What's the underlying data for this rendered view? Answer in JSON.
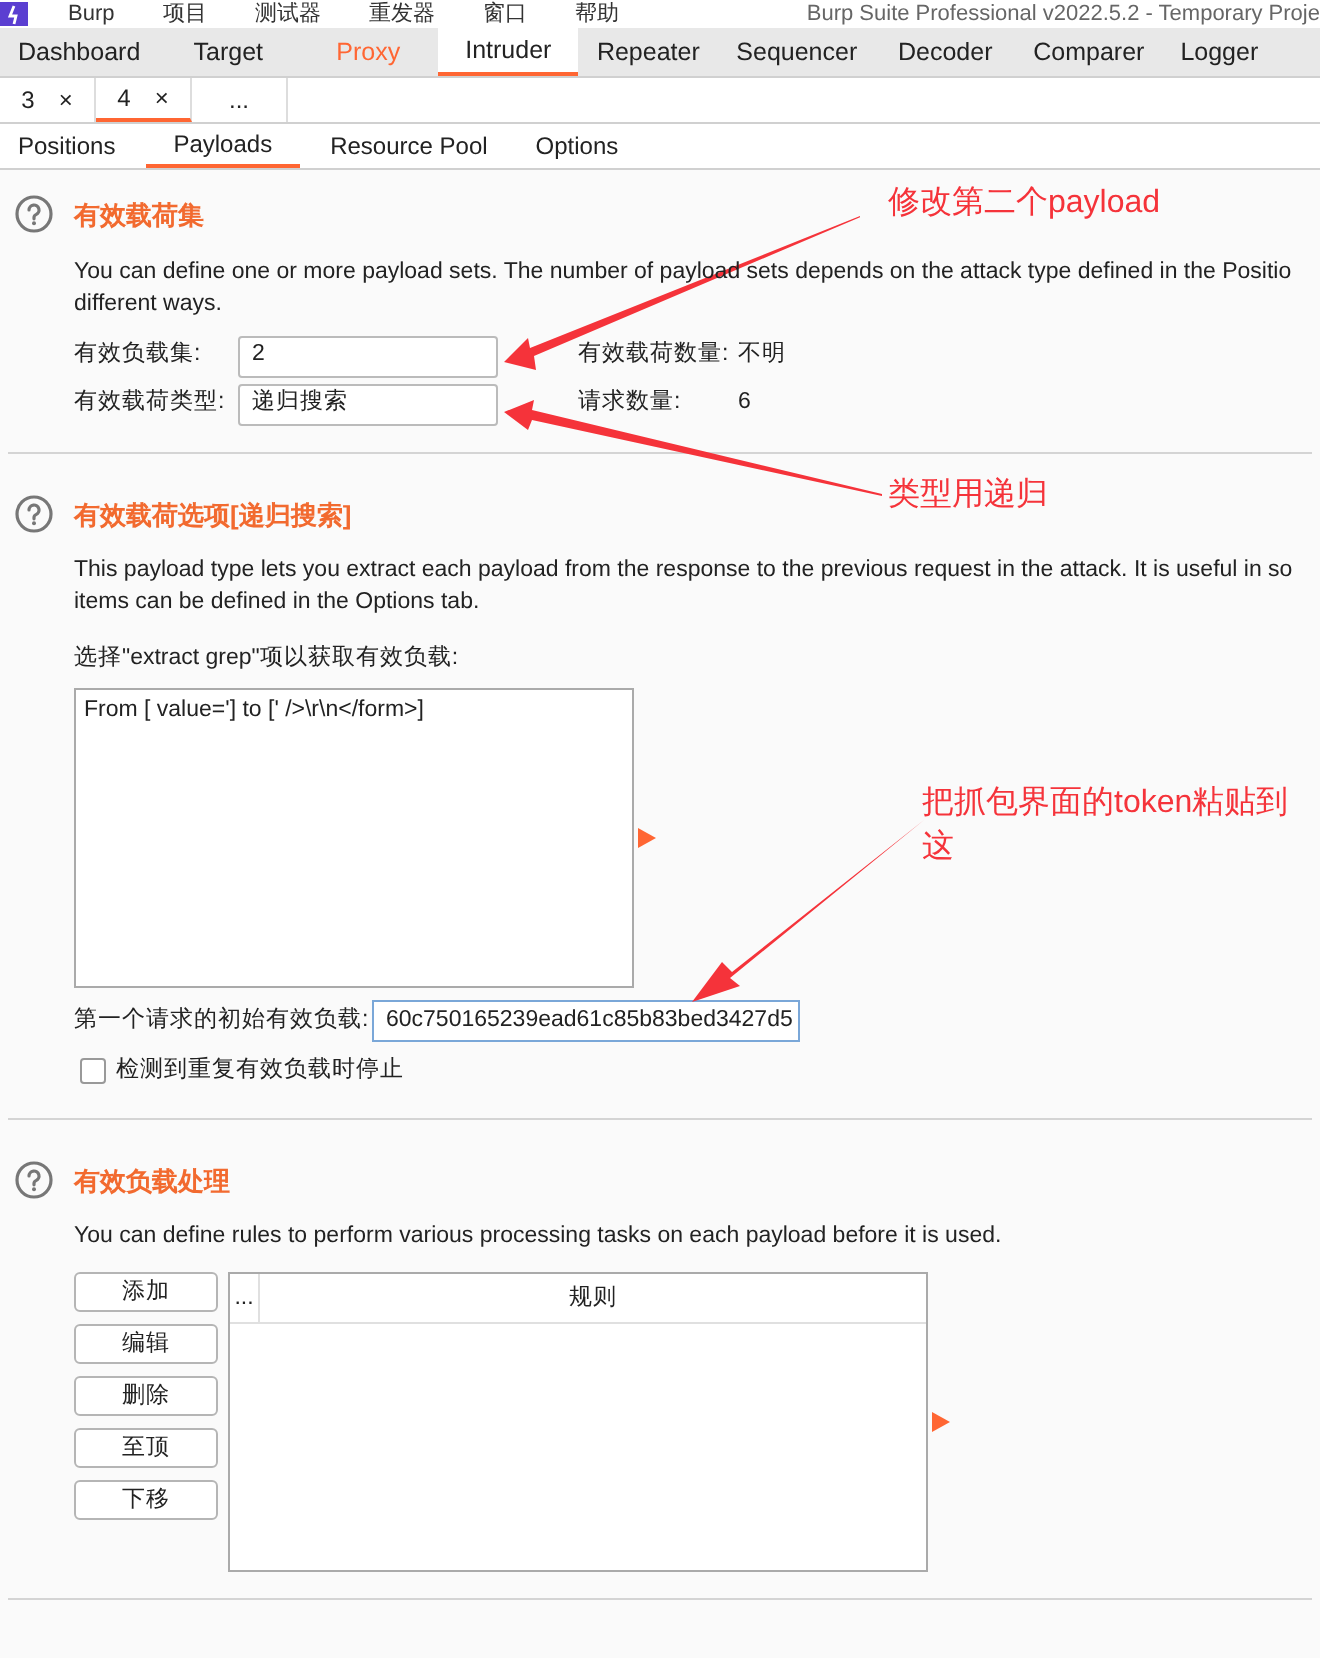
{
  "menu_bar": {
    "items": [
      "Burp",
      "项目",
      "测试器",
      "重发器",
      "窗口",
      "帮助"
    ],
    "title": "Burp Suite Professional v2022.5.2 - Temporary Proje"
  },
  "main_tabs": [
    {
      "label": "Dashboard",
      "selected": false,
      "highlighted": false
    },
    {
      "label": "Target",
      "selected": false,
      "highlighted": false
    },
    {
      "label": "Proxy",
      "selected": false,
      "highlighted": true
    },
    {
      "label": "Intruder",
      "selected": true,
      "highlighted": false
    },
    {
      "label": "Repeater",
      "selected": false,
      "highlighted": false
    },
    {
      "label": "Sequencer",
      "selected": false,
      "highlighted": false
    },
    {
      "label": "Decoder",
      "selected": false,
      "highlighted": false
    },
    {
      "label": "Comparer",
      "selected": false,
      "highlighted": false
    },
    {
      "label": "Logger",
      "selected": false,
      "highlighted": false
    }
  ],
  "attack_tabs": [
    {
      "label": "3",
      "close": "×",
      "selected": false
    },
    {
      "label": "4",
      "close": "×",
      "selected": true
    },
    {
      "label": "...",
      "selected": false
    }
  ],
  "sub_tabs": [
    {
      "label": "Positions",
      "selected": false
    },
    {
      "label": "Payloads",
      "selected": true
    },
    {
      "label": "Resource Pool",
      "selected": false
    },
    {
      "label": "Options",
      "selected": false
    }
  ],
  "payload_sets": {
    "title": "有效载荷集",
    "description_lines": [
      "You can define one or more payload sets. The number of payload sets depends on the attack type defined in the Positio",
      "different ways."
    ],
    "payload_set_label": "有效负载集:",
    "payload_set_value": "2",
    "payload_count_label": "有效载荷数量:",
    "payload_count_value": "不明",
    "payload_type_label": "有效载荷类型:",
    "payload_type_value": "递归搜索",
    "request_count_label": "请求数量:",
    "request_count_value": "6"
  },
  "payload_options": {
    "title": "有效载荷选项[递归搜索]",
    "description_lines": [
      "This payload type lets you extract each payload from the response to the previous request in the attack. It is useful in so",
      "items can be defined in the Options tab."
    ],
    "grep_label": "选择\"extract grep\"项以获取有效负载:",
    "grep_items": [
      "From [ value='] to [' />\\r\\n</form>]"
    ],
    "initial_payload_label": "第一个请求的初始有效负载:",
    "initial_payload_value": "60c750165239ead61c85b83bed3427d5",
    "stop_on_duplicate": {
      "label": "检测到重复有效负载时停止",
      "checked": false
    }
  },
  "payload_processing": {
    "title": "有效负载处理",
    "description": "You can define rules to perform various processing tasks on each payload before it is used.",
    "buttons": [
      "添加",
      "编辑",
      "删除",
      "至顶",
      "下移"
    ],
    "columns": [
      "...",
      "规则"
    ]
  },
  "annotations": [
    {
      "text": "修改第二个payload"
    },
    {
      "text": "类型用递归"
    },
    {
      "text": "把抓包界面的token粘贴到这"
    }
  ]
}
